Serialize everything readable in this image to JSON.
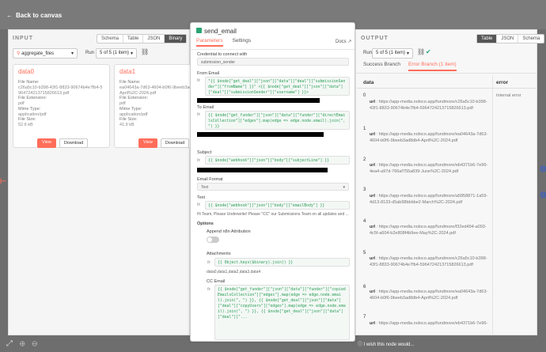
{
  "topbar": {
    "back_label": "Back to canvas"
  },
  "bottombar": {
    "message": "I wish this node would..."
  },
  "input_panel": {
    "title": "INPUT",
    "view_tabs": [
      "Schema",
      "Table",
      "JSON",
      "Binary"
    ],
    "active_view": "Binary",
    "node_select": "aggregate_files",
    "run_label": "Run",
    "run_select": "5 of 5 (1 item)",
    "cards": [
      {
        "name": "data0",
        "file_name_label": "File Name:",
        "file_name": "c26a5c10-b398-43f1-8833-90674b4e7fb4-5964724213715826613.pdf",
        "file_ext_label": "File Extension:",
        "file_ext": "pdf",
        "mime_label": "Mime Type:",
        "mime": "application/pdf",
        "size_label": "File Size:",
        "size": "52.6 kB",
        "view_label": "View",
        "download_label": "Download"
      },
      {
        "name": "data1",
        "file_name_label": "File Name:",
        "file_name": "ea04643a-7d63-4604-b0f6-9beeb3ad8db4-April%2C-2024.pdf",
        "file_ext_label": "File Extension:",
        "file_ext": "pdf",
        "mime_label": "Mime Type:",
        "mime": "application/pdf",
        "size_label": "File Size:",
        "size": "41.9 kB",
        "view_label": "View",
        "download_label": "Download"
      }
    ]
  },
  "node_modal": {
    "title": "send_email",
    "tabs": [
      "Parameters",
      "Settings"
    ],
    "active_tab": "Parameters",
    "docs_label": "Docs",
    "credential_label": "Credential to connect with",
    "credential_value": "submission_sender",
    "from_email_label": "From Email",
    "from_email_expr": "\"{{ $node[\"get_deal\"][\"json\"][\"data\"][\"deal\"][\"submissionSender\"][\"fromName\"] }}\" <{{ $node[\"get_deal\"][\"json\"][\"data\"][\"deal\"][\"submissionSender\"][\"username\"] }}>",
    "to_email_label": "To Email",
    "to_email_expr": "{{ $node[\"get_funder\"][\"json\"][\"data\"][\"funder\"][\"directEmailsCollection\"][\"edges\"].map(edge => edge.node.email).join(\", \") }}",
    "subject_label": "Subject",
    "subject_expr": "{{ $node[\"webhook\"][\"json\"][\"body\"][\"subjectLine\"] }}",
    "email_format_label": "Email Format",
    "email_format_value": "Text",
    "text_label": "Text",
    "text_expr": "{{ $node[\"webhook\"][\"json\"][\"body\"][\"emailBody\"] }}",
    "text_result": "Hi Team,   Please Underwrite!   Please \"CC\" our Submissions Team on all updates and ...",
    "options_label": "Options",
    "append_label": "Append n8n Attribution",
    "attachments_label": "Attachments",
    "attachments_expr": "{{ Object.keys($binary).join() }}",
    "attachments_result": "data0,data1,data2,data3,data4",
    "cc_label": "CC Email",
    "cc_expr": "{{ $node[\"get_funder\"][\"json\"][\"data\"][\"funder\"][\"copiedEmailsCollection\"][\"edges\"].map(edge => edge.node.email).join(\", \") }}, {{ $node[\"get_deal\"][\"json\"][\"data\"][\"deal\"][\"copyUsers\"][\"edges\"].map(edge => edge.node.email).join(\", \") }}, {{ $node[\"get_deal\"][\"json\"][\"data\"][\"deal\"][\"..."
  },
  "output_panel": {
    "title": "OUTPUT",
    "view_tabs": [
      "Table",
      "JSON",
      "Schema"
    ],
    "active_view": "Table",
    "run_label": "Run",
    "run_select": "5 of 5 (1 item)",
    "branch_tabs": [
      "Success Branch",
      "Error Branch (1 item)"
    ],
    "active_branch": "Error Branch (1 item)",
    "columns": [
      "data",
      "error"
    ],
    "error_value": "Internal error",
    "url_key": "url",
    "rows": [
      {
        "index": "0",
        "url": "https://app-media.noloco.app/fundmore/c26a5c10-b398-43f1-8833-90674b4e7fb4-5964724213715826613.pdf"
      },
      {
        "index": "1",
        "url": "https://app-media.noloco.app/fundmore/ea04643a-7d63-4604-b0f6-9beeb3ad8db4-April%2C-2024.pdf"
      },
      {
        "index": "2",
        "url": "https://app-media.noloco.app/fundmore/eb4371b6-7e96-4ea4-a97d-766af755a839-June%2C-2024.pdf"
      },
      {
        "index": "3",
        "url": "https://app-media.noloco.app/fundmore/a5858871-1a59-4d13-8133-d5ab98bbbbe2-March%2C-2024.pdf"
      },
      {
        "index": "4",
        "url": "https://app-media.noloco.app/fundmore/f32ed494-a093-4c5f-a604-b2e808f4b9ee-May%2C-2024.pdf"
      },
      {
        "index": "5",
        "url": "https://app-media.noloco.app/fundmore/c26a5c10-b398-43f1-8833-90674b4e7fb4-5964724213715826613.pdf"
      },
      {
        "index": "6",
        "url": "https://app-media.noloco.app/fundmore/ea04643a-7d63-4604-b0f6-9beeb3ad8db4-April%2C-2024.pdf"
      },
      {
        "index": "7",
        "url": "https://app-media.noloco.app/fundmore/eb4371b6-7e96-"
      }
    ]
  },
  "colors": {
    "accent": "#ff6d5a",
    "expr_green": "#2a9d55",
    "node_green": "#2aa574"
  }
}
